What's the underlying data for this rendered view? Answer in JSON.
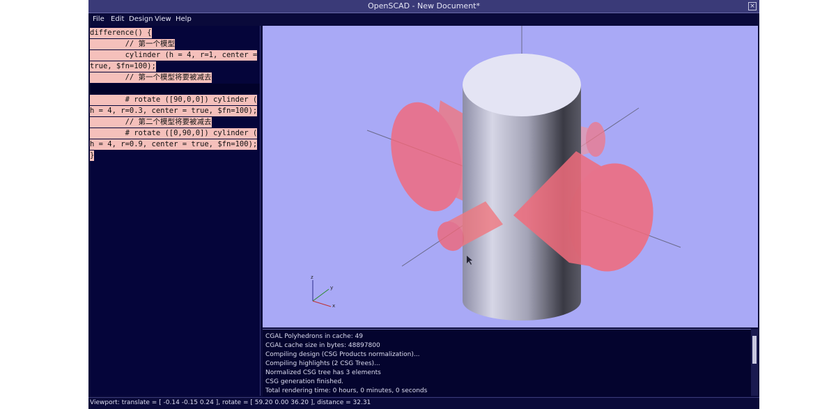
{
  "window": {
    "title": "OpenSCAD - New Document*",
    "close_icon": "close-icon"
  },
  "menu": [
    "File",
    "Edit",
    "Design",
    "View",
    "Help"
  ],
  "editor": {
    "lines": [
      "difference() {",
      "        // 第一个模型",
      "        cylinder (h = 4, r=1, center =",
      "true, $fn=100);",
      "        // 第一个模型将要被减去",
      "",
      "        # rotate ([90,0,0]) cylinder (",
      "h = 4, r=0.3, center = true, $fn=100);",
      "        // 第二个模型将要被减去",
      "        # rotate ([0,90,0]) cylinder (",
      "h = 4, r=0.9, center = true, $fn=100);",
      "}"
    ]
  },
  "viewport": {
    "axes_icon_labels": [
      "z",
      "y",
      "x"
    ],
    "colors": {
      "background": "#a9a9f6",
      "main_cylinder": "#c4c4e8",
      "subtract": "#f07880"
    }
  },
  "console": {
    "lines": [
      "CGAL Polyhedrons in cache: 49",
      "CGAL cache size in bytes: 48897800",
      "Compiling design (CSG Products normalization)...",
      "Compiling highlights (2 CSG Trees)...",
      "Normalized CSG tree has 3 elements",
      "CSG generation finished.",
      "Total rendering time: 0 hours, 0 minutes, 0 seconds"
    ]
  },
  "status": "Viewport: translate = [ -0.14 -0.15 0.24 ], rotate = [ 59.20 0.00 36.20 ], distance = 32.31"
}
